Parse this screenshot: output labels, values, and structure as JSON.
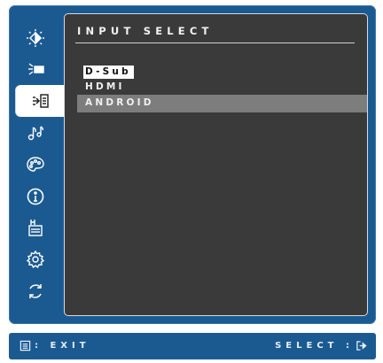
{
  "sidebar": {
    "items": [
      {
        "icon": "brightness-contrast-icon",
        "active": false
      },
      {
        "icon": "color-adjust-icon",
        "active": false
      },
      {
        "icon": "input-select-icon",
        "active": true
      },
      {
        "icon": "audio-adjust-icon",
        "active": false
      },
      {
        "icon": "color-palette-icon",
        "active": false
      },
      {
        "icon": "information-icon",
        "active": false
      },
      {
        "icon": "manual-image-adjust-icon",
        "active": false
      },
      {
        "icon": "setup-menu-icon",
        "active": false
      },
      {
        "icon": "memory-recall-icon",
        "active": false
      }
    ]
  },
  "panel": {
    "title": "INPUT SELECT",
    "options": [
      {
        "label": "D-Sub",
        "state": "current"
      },
      {
        "label": "HDMI",
        "state": "normal"
      },
      {
        "label": "ANDROID",
        "state": "highlighted"
      }
    ]
  },
  "bottom_bar": {
    "exit_label": ": EXIT",
    "exit_icon": "menu-icon",
    "select_label": "SELECT :",
    "select_icon": "enter-icon"
  },
  "colors": {
    "osd_blue": "#1b5a91",
    "panel_bg": "#3a3a3a",
    "highlight_row": "#7d7d7d"
  }
}
